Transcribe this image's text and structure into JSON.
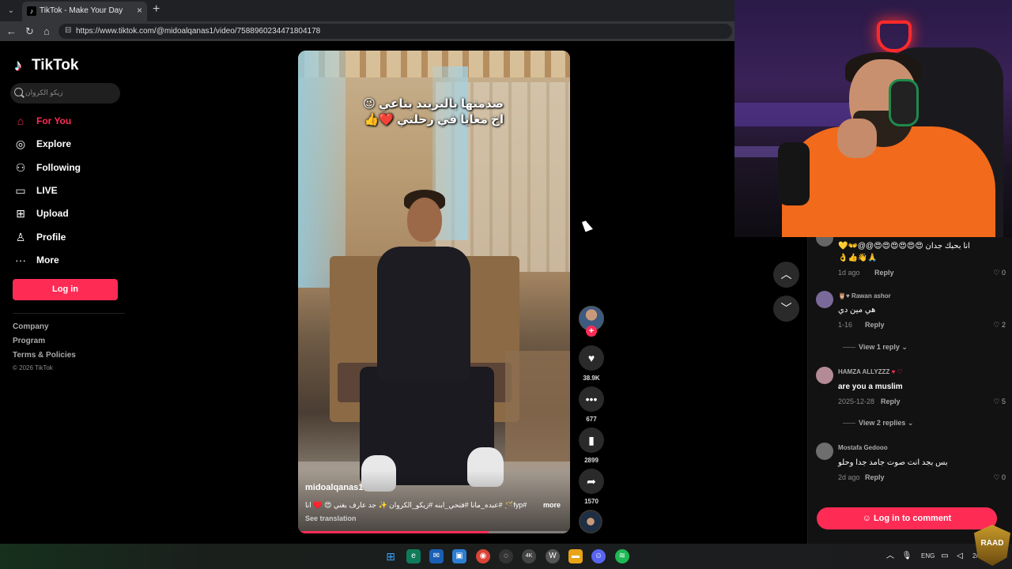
{
  "browser": {
    "tab_title": "TikTok - Make Your Day",
    "url": "https://www.tiktok.com/@midoalqanas1/video/7588960234471804178"
  },
  "sidebar": {
    "brand": "TikTok",
    "search_placeholder": "زيكو الكروان",
    "items": [
      {
        "label": "For You",
        "icon": "home-icon",
        "active": true
      },
      {
        "label": "Explore",
        "icon": "compass-icon"
      },
      {
        "label": "Following",
        "icon": "following-icon"
      },
      {
        "label": "LIVE",
        "icon": "live-icon"
      },
      {
        "label": "Upload",
        "icon": "upload-icon"
      },
      {
        "label": "Profile",
        "icon": "profile-icon"
      },
      {
        "label": "More",
        "icon": "more-icon"
      }
    ],
    "login_label": "Log in",
    "footer": [
      "Company",
      "Program",
      "Terms & Policies"
    ],
    "copyright": "© 2026 TikTok"
  },
  "video": {
    "overlay_line1": "صدمتها بالتريند بتاعي 😉",
    "overlay_line2": "اخ معايا في رحلتي ❤️👍",
    "author": "midoalqanas1",
    "caption": "#fyp🪄 #عبده_مانا #فتحي_ابنه #زيكو_الكروان ✨ جد عارف بغني 😍 ♥️ انا",
    "more_label": "more",
    "translate_label": "See translation",
    "progress": 0.7
  },
  "actions": {
    "likes": "38.9K",
    "comments": "677",
    "saves": "2899",
    "shares": "1570"
  },
  "comments": {
    "items": [
      {
        "user": "",
        "text": "انا بحبك جدان 😍😍😍😍😍😍@@👐💛",
        "text2": "👌👍👋🙏",
        "date": "1d ago",
        "likes": "0"
      },
      {
        "user": "Rawan ashor",
        "text": "هي مين دي",
        "date": "1-16",
        "likes": "2",
        "view_replies": "View 1 reply"
      },
      {
        "user": "HAMZA ALLYZZZ",
        "text": "are you a muslim",
        "date": "2025-12-28",
        "likes": "5",
        "view_replies": "View 2 replies"
      },
      {
        "user": "Mostafa Gedooo",
        "text": "بس بجد انت صوت جامد جدا وحلو",
        "date": "2d ago",
        "likes": "0"
      }
    ],
    "reply_label": "Reply",
    "login_label": "Log in to comment"
  },
  "taskbar": {
    "language": "ENG",
    "clock": "2/1"
  },
  "badge": "RAAD"
}
